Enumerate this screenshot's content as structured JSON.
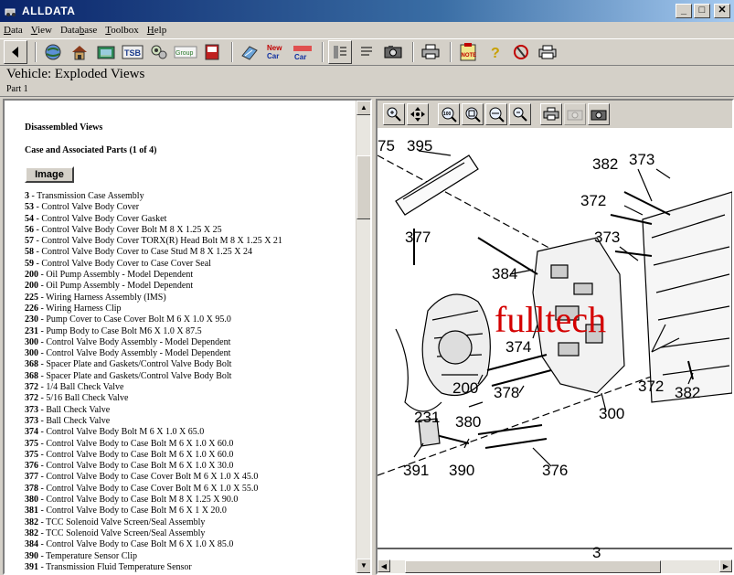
{
  "window": {
    "title": "ALLDATA"
  },
  "menus": [
    {
      "pre": "",
      "key": "D",
      "post": "ata"
    },
    {
      "pre": "",
      "key": "V",
      "post": "iew"
    },
    {
      "pre": "Data",
      "key": "b",
      "post": "ase"
    },
    {
      "pre": "",
      "key": "T",
      "post": "oolbox"
    },
    {
      "pre": "",
      "key": "H",
      "post": "elp"
    }
  ],
  "toolbar": {
    "icons": [
      "back-icon",
      "globe-icon",
      "home-icon",
      "vehicle-icon",
      "tsb-icon",
      "components-icon",
      "group-icon",
      "book-icon",
      "spec-icon",
      "new-car-icon",
      "car-icon",
      "view-full-icon",
      "view-text-icon",
      "camera-icon",
      "print-icon",
      "note-icon",
      "help-icon",
      "exit-icon",
      "printer-setup-icon"
    ],
    "labels": {
      "tsb": "TSB",
      "group": "Group",
      "new_car_1": "New",
      "new_car_2": "Car",
      "car": "Car",
      "note": "NOTE"
    }
  },
  "vehicle": {
    "title": "Vehicle:  Exploded Views",
    "part": "Part 1"
  },
  "left": {
    "heading": "Disassembled Views",
    "subheading": "Case and Associated Parts (1 of 4)",
    "image_button": "Image",
    "parts": [
      {
        "num": "3",
        "desc": " - Transmission Case Assembly"
      },
      {
        "num": "53",
        "desc": " - Control Valve Body Cover"
      },
      {
        "num": "54",
        "desc": " - Control Valve Body Cover Gasket"
      },
      {
        "num": "56",
        "desc": " - Control Valve Body Cover Bolt M 8 X 1.25 X 25"
      },
      {
        "num": "57",
        "desc": " - Control Valve Body Cover TORX(R) Head Bolt M 8 X 1.25 X 21"
      },
      {
        "num": "58",
        "desc": " - Control Valve Body Cover to Case Stud M 8 X 1.25 X 24"
      },
      {
        "num": "59",
        "desc": " - Control Valve Body Cover to Case Cover Seal"
      },
      {
        "num": "200",
        "desc": " - Oil Pump Assembly - Model Dependent"
      },
      {
        "num": "200",
        "desc": " - Oil Pump Assembly - Model Dependent"
      },
      {
        "num": "225",
        "desc": " - Wiring Harness Assembly (IMS)"
      },
      {
        "num": "226",
        "desc": " - Wiring Harness Clip"
      },
      {
        "num": "230",
        "desc": " - Pump Cover to Case Cover Bolt M 6 X 1.0 X 95.0"
      },
      {
        "num": "231",
        "desc": " - Pump Body to Case Bolt M6 X 1.0 X 87.5"
      },
      {
        "num": "300",
        "desc": " - Control Valve Body Assembly - Model Dependent"
      },
      {
        "num": "300",
        "desc": " - Control Valve Body Assembly - Model Dependent"
      },
      {
        "num": "368",
        "desc": " - Spacer Plate and Gaskets/Control Valve Body Bolt"
      },
      {
        "num": "368",
        "desc": " - Spacer Plate and Gaskets/Control Valve Body Bolt"
      },
      {
        "num": "372",
        "desc": " - 1/4 Ball Check Valve"
      },
      {
        "num": "372",
        "desc": " - 5/16 Ball Check Valve"
      },
      {
        "num": "373",
        "desc": " - Ball Check Valve"
      },
      {
        "num": "373",
        "desc": " - Ball Check Valve"
      },
      {
        "num": "374",
        "desc": " - Control Valve Body Bolt M 6 X 1.0 X 65.0"
      },
      {
        "num": "375",
        "desc": " - Control Valve Body to Case Bolt M 6 X 1.0 X 60.0"
      },
      {
        "num": "375",
        "desc": " - Control Valve Body to Case Bolt M 6 X 1.0 X 60.0"
      },
      {
        "num": "376",
        "desc": " - Control Valve Body to Case Bolt M 6 X 1.0 X 30.0"
      },
      {
        "num": "377",
        "desc": " - Control Valve Body to Case Cover Bolt M 6 X 1.0 X 45.0"
      },
      {
        "num": "378",
        "desc": " - Control Valve Body to Case Cover Bolt M 6 X 1.0 X 55.0"
      },
      {
        "num": "380",
        "desc": " - Control Valve Body to Case Bolt M 8 X 1.25 X 90.0"
      },
      {
        "num": "381",
        "desc": " - Control Valve Body to Case Bolt M 6 X 1 X 20.0"
      },
      {
        "num": "382",
        "desc": " - TCC Solenoid Valve Screen/Seal Assembly"
      },
      {
        "num": "382",
        "desc": " - TCC Solenoid Valve Screen/Seal Assembly"
      },
      {
        "num": "384",
        "desc": " - Control Valve Body to Case Bolt M 6 X 1.0 X 85.0"
      },
      {
        "num": "390",
        "desc": " - Temperature Sensor Clip"
      },
      {
        "num": "391",
        "desc": " - Transmission Fluid Temperature Sensor"
      }
    ]
  },
  "diagram": {
    "tools": [
      "zoom-in-icon",
      "pan-icon",
      "zoom-100-icon",
      "zoom-fit-icon",
      "zoom-window-icon",
      "zoom-out-icon",
      "print-icon",
      "copy-icon",
      "camera-icon"
    ],
    "callouts": [
      "75",
      "395",
      "382",
      "373",
      "372",
      "373",
      "377",
      "384",
      "374",
      "200",
      "378",
      "380",
      "231",
      "300",
      "372",
      "382",
      "391",
      "390",
      "376",
      "3"
    ],
    "watermark": "fulltech"
  }
}
